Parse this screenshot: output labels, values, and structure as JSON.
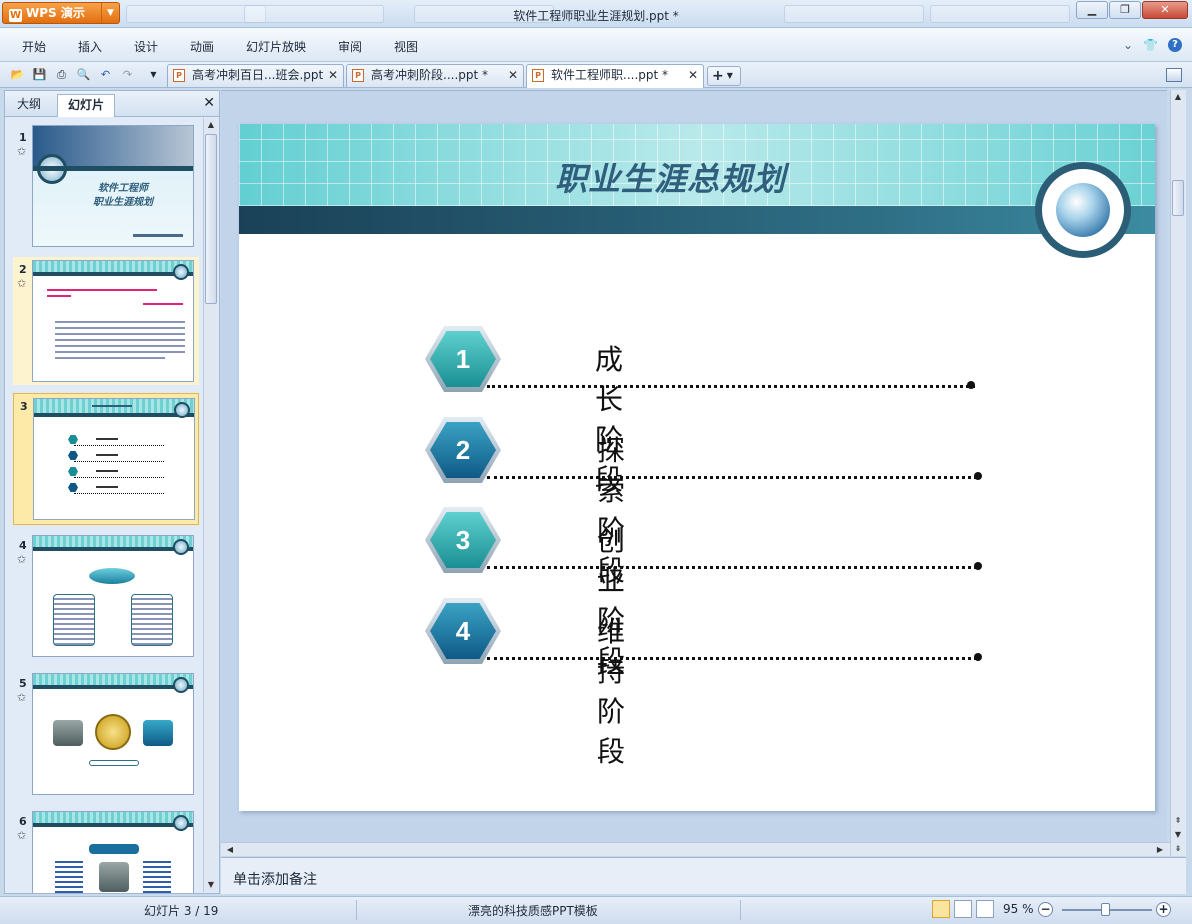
{
  "window": {
    "title": "软件工程师职业生涯规划.ppt *",
    "app_name": "WPS 演示",
    "app_logo": "W"
  },
  "menu": {
    "items": [
      "开始",
      "插入",
      "设计",
      "动画",
      "幻灯片放映",
      "审阅",
      "视图"
    ]
  },
  "tabs": [
    {
      "label": "高考冲刺百日...班会.ppt",
      "active": false
    },
    {
      "label": "高考冲刺阶段....ppt *",
      "active": false
    },
    {
      "label": "软件工程师职....ppt *",
      "active": true
    }
  ],
  "panel": {
    "tabs": [
      "大纲",
      "幻灯片"
    ],
    "active_tab": "幻灯片"
  },
  "thumbnails": [
    {
      "num": "1",
      "title": "软件工程师\n职业生涯规划"
    },
    {
      "num": "2"
    },
    {
      "num": "3",
      "selected": true
    },
    {
      "num": "4"
    },
    {
      "num": "5"
    },
    {
      "num": "6"
    }
  ],
  "slide": {
    "title": "职业生涯总规划",
    "items": [
      {
        "num": "1",
        "label": "成长阶段",
        "color": "teal"
      },
      {
        "num": "2",
        "label": "探索阶段",
        "color": "blue"
      },
      {
        "num": "3",
        "label": "创业阶段",
        "color": "teal"
      },
      {
        "num": "4",
        "label": "维持阶段",
        "color": "blue"
      }
    ]
  },
  "notes": {
    "placeholder": "单击添加备注"
  },
  "status": {
    "slide_info": "幻灯片 3 / 19",
    "template": "漂亮的科技质感PPT模板",
    "zoom": "95 %",
    "zoom_fraction": 0.48
  },
  "colors": {
    "accent": "#e26f10",
    "slide_teal": "#63cfd2",
    "slide_dark": "#1a4157"
  }
}
